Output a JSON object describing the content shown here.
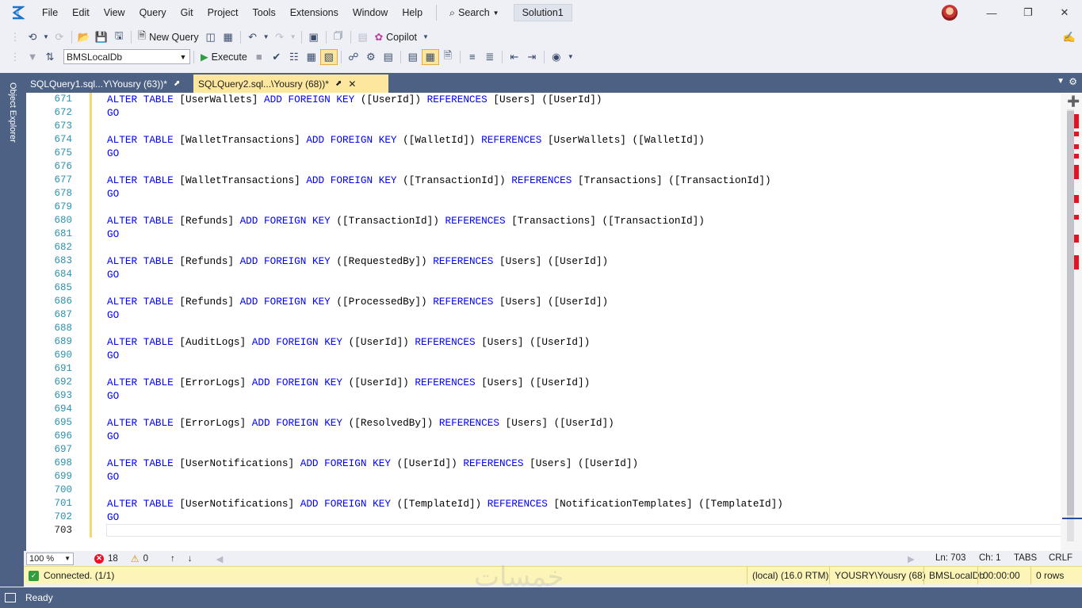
{
  "menubar": {
    "items": [
      "File",
      "Edit",
      "View",
      "Query",
      "Git",
      "Project",
      "Tools",
      "Extensions",
      "Window",
      "Help"
    ],
    "search_label": "Search",
    "solution_name": "Solution1"
  },
  "toolbar": {
    "new_query_label": "New Query",
    "copilot_label": "Copilot",
    "database": "BMSLocalDb",
    "execute_label": "Execute"
  },
  "side": {
    "object_explorer_label": "Object Explorer"
  },
  "tabs": [
    {
      "label": "SQLQuery1.sql...Y\\Yousry (63))*",
      "active": false
    },
    {
      "label": "SQLQuery2.sql...\\Yousry (68))*",
      "active": true
    }
  ],
  "editor": {
    "line_numbers": [
      "671",
      "672",
      "673",
      "674",
      "675",
      "676",
      "677",
      "678",
      "679",
      "680",
      "681",
      "682",
      "683",
      "684",
      "685",
      "686",
      "687",
      "688",
      "689",
      "690",
      "691",
      "692",
      "693",
      "694",
      "695",
      "696",
      "697",
      "698",
      "699",
      "700",
      "701",
      "702",
      "703"
    ],
    "statements": [
      {
        "table": "[UserWallets]",
        "cols": "([UserId])",
        "ref_table": "[Users]",
        "ref_cols": "([UserId])"
      },
      {
        "table": "[WalletTransactions]",
        "cols": "([WalletId])",
        "ref_table": "[UserWallets]",
        "ref_cols": "([WalletId])"
      },
      {
        "table": "[WalletTransactions]",
        "cols": "([TransactionId])",
        "ref_table": "[Transactions]",
        "ref_cols": "([TransactionId])"
      },
      {
        "table": "[Refunds]",
        "cols": "([TransactionId])",
        "ref_table": "[Transactions]",
        "ref_cols": "([TransactionId])"
      },
      {
        "table": "[Refunds]",
        "cols": "([RequestedBy])",
        "ref_table": "[Users]",
        "ref_cols": "([UserId])"
      },
      {
        "table": "[Refunds]",
        "cols": "([ProcessedBy])",
        "ref_table": "[Users]",
        "ref_cols": "([UserId])"
      },
      {
        "table": "[AuditLogs]",
        "cols": "([UserId])",
        "ref_table": "[Users]",
        "ref_cols": "([UserId])"
      },
      {
        "table": "[ErrorLogs]",
        "cols": "([UserId])",
        "ref_table": "[Users]",
        "ref_cols": "([UserId])"
      },
      {
        "table": "[ErrorLogs]",
        "cols": "([ResolvedBy])",
        "ref_table": "[Users]",
        "ref_cols": "([UserId])"
      },
      {
        "table": "[UserNotifications]",
        "cols": "([UserId])",
        "ref_table": "[Users]",
        "ref_cols": "([UserId])"
      },
      {
        "table": "[UserNotifications]",
        "cols": "([TemplateId])",
        "ref_table": "[NotificationTemplates]",
        "ref_cols": "([TemplateId])"
      }
    ],
    "kw_alter": "ALTER",
    "kw_table": "TABLE",
    "kw_add": "ADD",
    "kw_foreign": "FOREIGN",
    "kw_key": "KEY",
    "kw_references": "REFERENCES",
    "kw_go": "GO"
  },
  "editor_status": {
    "zoom": "100 %",
    "errors": "18",
    "warnings": "0",
    "line": "Ln: 703",
    "column": "Ch: 1",
    "indent": "TABS",
    "line_ending": "CRLF"
  },
  "connection": {
    "status": "Connected. (1/1)",
    "server": "(local) (16.0 RTM)",
    "user": "YOUSRY\\Yousry (68)",
    "database": "BMSLocalDb",
    "elapsed": "00:00:00",
    "rows": "0 rows"
  },
  "watermark": "خمسات",
  "status_bar": {
    "text": "Ready"
  },
  "colors": {
    "keyword": "#0000ff",
    "line_number": "#2b91af",
    "chrome": "#4d6185",
    "conn_bar": "#fcf4b8",
    "error_mark": "#e81123"
  }
}
